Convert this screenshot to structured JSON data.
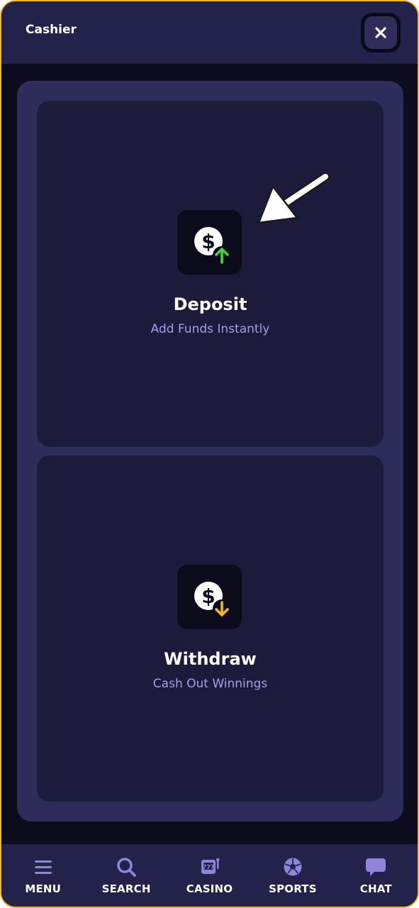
{
  "header": {
    "title": "Cashier",
    "close_icon": "close-icon"
  },
  "cards": {
    "deposit": {
      "title": "Deposit",
      "subtitle": "Add Funds Instantly",
      "icon": "dollar-up-icon",
      "accent": "#3ddc2a"
    },
    "withdraw": {
      "title": "Withdraw",
      "subtitle": "Cash Out Winnings",
      "icon": "dollar-down-icon",
      "accent": "#f5b91c"
    }
  },
  "nav": [
    {
      "label": "MENU",
      "icon": "menu-icon"
    },
    {
      "label": "SEARCH",
      "icon": "search-icon"
    },
    {
      "label": "CASINO",
      "icon": "slot-machine-icon"
    },
    {
      "label": "SPORTS",
      "icon": "soccer-ball-icon"
    },
    {
      "label": "CHAT",
      "icon": "chat-icon"
    }
  ],
  "colors": {
    "header_bg": "#23224a",
    "panel_bg": "#2e2c5a",
    "card_bg": "#1c1b3c",
    "subtitle": "#a99be8",
    "nav_icon": "#8f83db",
    "frame_border": "#f3b820"
  }
}
